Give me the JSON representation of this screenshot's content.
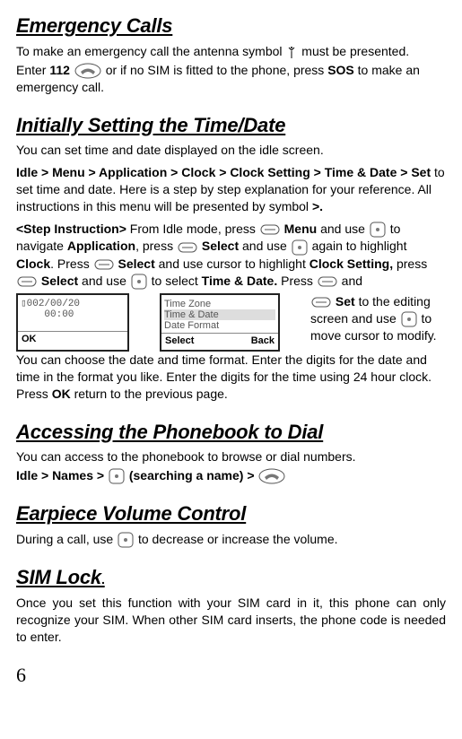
{
  "emergency": {
    "title": "Emergency Calls",
    "p1a": "To make an emergency call the antenna symbol ",
    "p1b": " must be presented.",
    "p2a": "Enter ",
    "code": "112",
    "p2b": " or if no SIM is fitted to the phone, press ",
    "sos": "SOS",
    "p2c": " to make an emergency call."
  },
  "time": {
    "title": "Initially Setting the Time/Date",
    "p1": "You can set time and date displayed on the idle screen.",
    "nav_path": "Idle > Menu > Application > Clock > Clock Setting > Time & Date > Set",
    "nav_tail": " to set time and date. Here is a step by step explanation for your reference. All instructions in this menu will be presented by symbol ",
    "bullet": ">.",
    "step_label": "<Step Instruction>",
    "s_a": " From Idle mode, press ",
    "menu": "Menu",
    "s_b": " and use ",
    "s_c": " to navigate ",
    "app": "Application",
    "s_d": ", press ",
    "sel": "Select",
    "s_e": " and use ",
    "s_f": " again to highlight ",
    "clock": "Clock",
    "s_g": ". Press ",
    "s_h": " and use cursor to highlight ",
    "cs": "Clock Setting,",
    "s_i": " press ",
    "s_j": " and use ",
    "s_k": " to select ",
    "td": "Time & Date.",
    "s_l": " Press ",
    "s_m": " and ",
    "set": "Set",
    "r1": " to the editing screen and use ",
    "r2": " to move cursor to modify.",
    "r3": "You can choose the date and time format. Enter the digits for the date and time in the format you like. Enter the digits for the time using 24 hour clock. Press ",
    "ok": "OK",
    "r4": " return to the previous page.",
    "scr1_line1": "▯002/00/20",
    "scr1_line2": "    00:00",
    "scr1_soft_l": "OK",
    "scr2_l1": "Time Zone",
    "scr2_l2": "Time & Date",
    "scr2_l3": "Date Format",
    "scr2_soft_l": "Select",
    "scr2_soft_r": "Back"
  },
  "phonebook": {
    "title": "Accessing the Phonebook to Dial",
    "p1": "You can access to the phonebook to browse or dial numbers.",
    "path_a": "Idle > Names > ",
    "path_b": " (searching a name) > "
  },
  "earpiece": {
    "title": "Earpiece Volume Control",
    "p_a": "During a call, use ",
    "p_b": "  to decrease or increase the volume."
  },
  "sim": {
    "title": "SIM Lock",
    "title_suffix": ".",
    "p": "Once you set this function with your SIM card in it, this phone can only recognize your SIM. When other SIM card inserts, the phone code is needed to enter."
  },
  "page_number": "6"
}
